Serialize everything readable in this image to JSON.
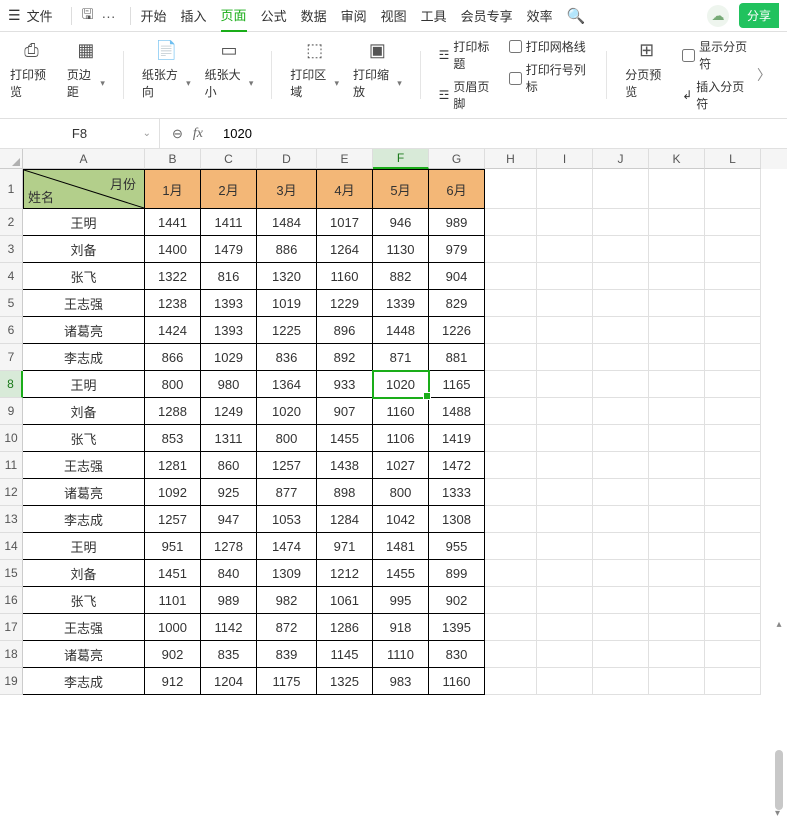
{
  "menubar": {
    "file": "文件",
    "tabs": [
      "开始",
      "插入",
      "页面",
      "公式",
      "数据",
      "审阅",
      "视图",
      "工具",
      "会员专享",
      "效率"
    ],
    "active_tab_index": 2,
    "share": "分享"
  },
  "ribbon": {
    "print_preview": "打印预览",
    "margins": "页边距",
    "orientation": "纸张方向",
    "size": "纸张大小",
    "print_area": "打印区域",
    "scaling": "打印缩放",
    "print_title": "打印标题",
    "header_footer": "页眉页脚",
    "gridlines": "打印网格线",
    "row_col_header": "打印行号列标",
    "page_break": "分页预览",
    "show_breaks": "显示分页符",
    "insert_break": "插入分页符"
  },
  "formula": {
    "cell_ref": "F8",
    "value": "1020"
  },
  "columns": [
    "A",
    "B",
    "C",
    "D",
    "E",
    "F",
    "G",
    "H",
    "I",
    "J",
    "K",
    "L"
  ],
  "selected_col_index": 5,
  "selected_row_index": 8,
  "header_row": {
    "diag_top": "月份",
    "diag_bottom": "姓名",
    "months": [
      "1月",
      "2月",
      "3月",
      "4月",
      "5月",
      "6月"
    ]
  },
  "data_rows": [
    {
      "name": "王明",
      "v": [
        1441,
        1411,
        1484,
        1017,
        946,
        989
      ]
    },
    {
      "name": "刘备",
      "v": [
        1400,
        1479,
        886,
        1264,
        1130,
        979
      ]
    },
    {
      "name": "张飞",
      "v": [
        1322,
        816,
        1320,
        1160,
        882,
        904
      ]
    },
    {
      "name": "王志强",
      "v": [
        1238,
        1393,
        1019,
        1229,
        1339,
        829
      ]
    },
    {
      "name": "诸葛亮",
      "v": [
        1424,
        1393,
        1225,
        896,
        1448,
        1226
      ]
    },
    {
      "name": "李志成",
      "v": [
        866,
        1029,
        836,
        892,
        871,
        881
      ]
    },
    {
      "name": "王明",
      "v": [
        800,
        980,
        1364,
        933,
        1020,
        1165
      ]
    },
    {
      "name": "刘备",
      "v": [
        1288,
        1249,
        1020,
        907,
        1160,
        1488
      ]
    },
    {
      "name": "张飞",
      "v": [
        853,
        1311,
        800,
        1455,
        1106,
        1419
      ]
    },
    {
      "name": "王志强",
      "v": [
        1281,
        860,
        1257,
        1438,
        1027,
        1472
      ]
    },
    {
      "name": "诸葛亮",
      "v": [
        1092,
        925,
        877,
        898,
        800,
        1333
      ]
    },
    {
      "name": "李志成",
      "v": [
        1257,
        947,
        1053,
        1284,
        1042,
        1308
      ]
    },
    {
      "name": "王明",
      "v": [
        951,
        1278,
        1474,
        971,
        1481,
        955
      ]
    },
    {
      "name": "刘备",
      "v": [
        1451,
        840,
        1309,
        1212,
        1455,
        899
      ]
    },
    {
      "name": "张飞",
      "v": [
        1101,
        989,
        982,
        1061,
        995,
        902
      ]
    },
    {
      "name": "王志强",
      "v": [
        1000,
        1142,
        872,
        1286,
        918,
        1395
      ]
    },
    {
      "name": "诸葛亮",
      "v": [
        902,
        835,
        839,
        1145,
        1110,
        830
      ]
    },
    {
      "name": "李志成",
      "v": [
        912,
        1204,
        1175,
        1325,
        983,
        1160
      ]
    }
  ]
}
